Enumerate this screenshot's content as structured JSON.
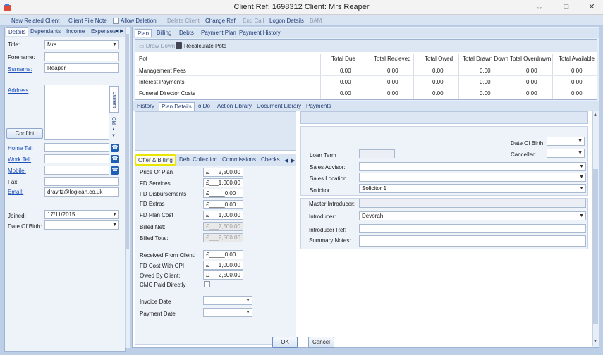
{
  "window": {
    "title": "Client Ref: 1698312 Client: Mrs  Reaper",
    "min": "↔",
    "restore": "□",
    "close": "✕"
  },
  "toolbar": {
    "new_related": "New Related Client",
    "file_note": "Client File Note",
    "allow_deletion": "Allow Deletion",
    "delete": "Delete Client",
    "change_ref": "Change Ref",
    "end_call": "End Call",
    "logon": "Logon Details",
    "bam": "BAM"
  },
  "left": {
    "tabs": [
      "Details",
      "Dependants",
      "Income",
      "Expenses"
    ],
    "title_lbl": "Title:",
    "title_val": "Mrs",
    "forename_lbl": "Forename:",
    "forename_val": "",
    "surname_lbl": "Surname:",
    "surname_val": "Reaper",
    "address_lbl": "Address",
    "current": "Current",
    "old": "Old",
    "conflict": "Conflict",
    "home_tel": "Home Tel:",
    "work_tel": "Work Tel:",
    "mobile": "Mobile:",
    "fax": "Fax:",
    "email_lbl": "Email:",
    "email_val": "dravitz@logican.co.uk",
    "joined_lbl": "Joined:",
    "joined_val": "17/11/2015",
    "dob_lbl": "Date Of Birth:",
    "dob_val": ""
  },
  "right": {
    "tabs": [
      "Plan",
      "Billing",
      "Debts",
      "Payment Plan",
      "Payment History"
    ],
    "draw_down": "Draw Down",
    "recalc": "Recalculate Pots",
    "grid": {
      "headers": [
        "Pot",
        "Total Due",
        "Total Recieved",
        "Total Owed",
        "Total Drawn Down",
        "Total Overdrawn",
        "Total Available"
      ],
      "rows": [
        [
          "Management Fees",
          "0.00",
          "0.00",
          "0.00",
          "0.00",
          "0.00",
          "0.00"
        ],
        [
          "Interest Payments",
          "0.00",
          "0.00",
          "0.00",
          "0.00",
          "0.00",
          "0.00"
        ],
        [
          "Funeral Director Costs",
          "0.00",
          "0.00",
          "0.00",
          "0.00",
          "0.00",
          "0.00"
        ]
      ]
    },
    "lower_tabs": [
      "History",
      "Plan Details",
      "To Do",
      "Action Library",
      "Document Library",
      "Payments"
    ],
    "sub_tabs": [
      "Offer & Billing",
      "Debt Collection",
      "Commissions",
      "Checks"
    ],
    "billing": {
      "price_lbl": "Price Of Plan",
      "price": "£___2,500.00",
      "fd_services_lbl": "FD Services",
      "fd_services": "£___1,000.00",
      "fd_disb_lbl": "FD Disbursements",
      "fd_disb": "£_____0.00",
      "fd_extras_lbl": "FD Extras",
      "fd_extras": "£_____0.00",
      "fd_plan_lbl": "FD Plan Cost",
      "fd_plan": "£___1,000.00",
      "billed_net_lbl": "Billed Net:",
      "billed_net": "£___2,500.00",
      "billed_total_lbl": "Billed Total:",
      "billed_total": "£___2,500.00",
      "received_lbl": "Received From Client:",
      "received": "£_____0.00",
      "fd_cpi_lbl": "FD Cost With CPI",
      "fd_cpi": "£___1,000.00",
      "owed_lbl": "Owed By Client:",
      "owed": "£___2,500.00",
      "cmc_lbl": "CMC Paid Directly",
      "invoice_lbl": "Invoice Date",
      "payment_lbl": "Payment Date"
    },
    "details": {
      "dob_lbl": "Date Of Birth",
      "cancelled_lbl": "Cancelled",
      "loan_term_lbl": "Loan Term",
      "sales_advisor_lbl": "Sales Advisor:",
      "sales_location_lbl": "Sales Location",
      "solicitor_lbl": "Solicitor",
      "solicitor_val": "Solicitor 1",
      "master_intro_lbl": "Master Introducer:",
      "introducer_lbl": "Introducer:",
      "introducer_val": "Devorah",
      "intro_ref_lbl": "Introducer Ref:",
      "summary_lbl": "Summary Notes:"
    }
  },
  "footer": {
    "ok": "OK",
    "cancel": "Cancel"
  },
  "colors": {
    "accent": "#1f5fb5",
    "highlight": "#e6e600"
  }
}
